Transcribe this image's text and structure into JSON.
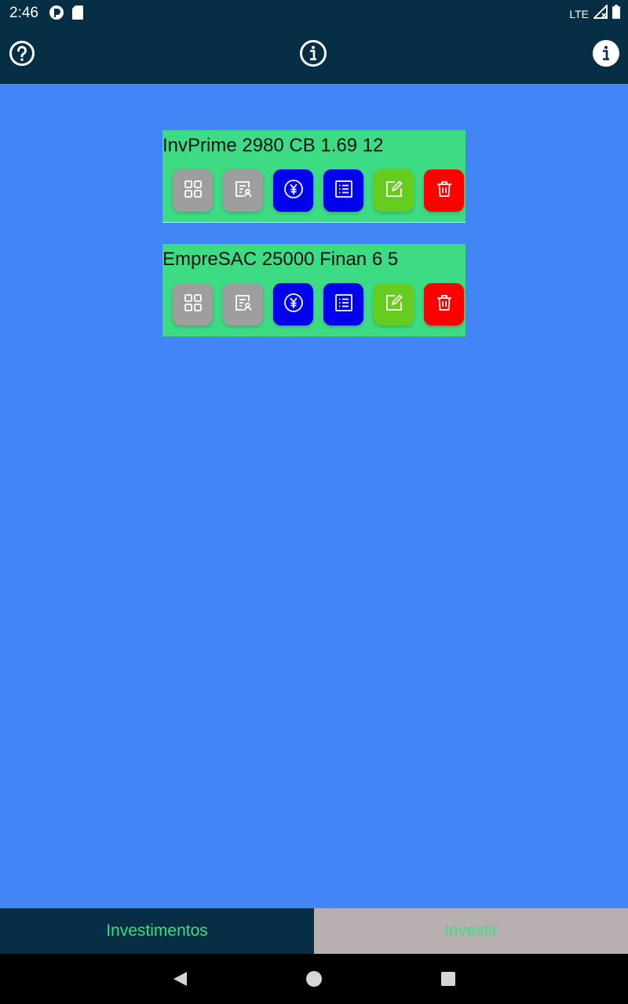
{
  "status_bar": {
    "time": "2:46",
    "network": "LTE",
    "icons": [
      "media-app-icon",
      "sd-card-icon",
      "signal-icon",
      "battery-icon"
    ]
  },
  "app_bar": {
    "icons": [
      "help-icon",
      "info-outline-icon",
      "info-filled-icon"
    ]
  },
  "investments": [
    {
      "title": "InvPrime 2980 CB 1.69 12",
      "actions": [
        "grid-icon",
        "contract-icon",
        "yen-icon",
        "list-icon",
        "edit-icon",
        "trash-icon"
      ]
    },
    {
      "title": "EmpreSAC 25000 Finan 6 5",
      "actions": [
        "grid-icon",
        "contract-icon",
        "yen-icon",
        "list-icon",
        "edit-icon",
        "trash-icon"
      ]
    }
  ],
  "tabs": {
    "investimentos": "Investimentos",
    "investir": "Investir"
  },
  "colors": {
    "header": "#062e45",
    "background": "#4285f4",
    "card": "#3ddc84",
    "tab_text": "#3ddc84",
    "tab_inactive_bg": "#b8b0b0",
    "action_gray": "#9e9e9e",
    "action_blue": "#0000ee",
    "action_green": "#66cc1e",
    "action_red": "#ff0000"
  }
}
